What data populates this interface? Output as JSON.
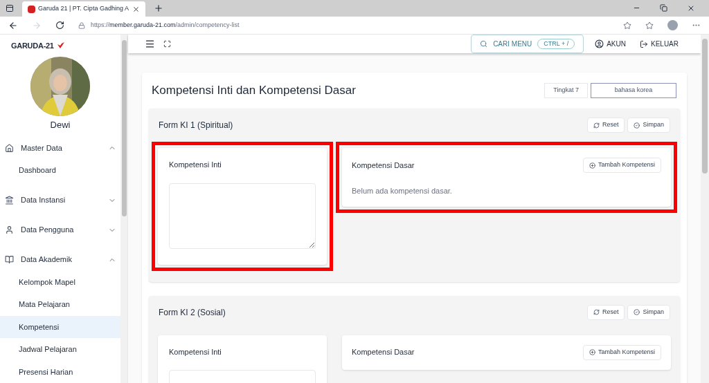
{
  "browser": {
    "tab_title": "Garuda 21 | PT. Cipta Gadhing A",
    "url_prefix": "https://",
    "url_host": "member.garuda-21.com",
    "url_path": "/admin/competency-list"
  },
  "sidebar": {
    "logo": "GARUDA-21",
    "user_name": "Dewi",
    "groups": [
      {
        "label": "Master Data",
        "expanded": true,
        "children": [
          {
            "label": "Dashboard",
            "selected": false
          }
        ]
      },
      {
        "label": "Data Instansi",
        "expanded": false
      },
      {
        "label": "Data Pengguna",
        "expanded": false
      },
      {
        "label": "Data Akademik",
        "expanded": true,
        "children": [
          {
            "label": "Kelompok Mapel",
            "selected": false
          },
          {
            "label": "Mata Pelajaran",
            "selected": false
          },
          {
            "label": "Kompetensi",
            "selected": true
          },
          {
            "label": "Jadwal Pelajaran",
            "selected": false
          },
          {
            "label": "Presensi Harian",
            "selected": false
          }
        ]
      }
    ]
  },
  "header": {
    "search_label": "CARI MENU",
    "shortcut": "CTRL + /",
    "account": "AKUN",
    "logout": "KELUAR"
  },
  "page": {
    "title": "Kompetensi Inti dan Kompetensi Dasar",
    "grade": "Tingkat 7",
    "subject": "bahasa korea"
  },
  "forms": [
    {
      "title": "Form KI 1 (Spiritual)",
      "reset": "Reset",
      "save": "Simpan",
      "ki": {
        "title": "Kompetensi Inti",
        "highlighted": true
      },
      "kd": {
        "title": "Kompetensi Dasar",
        "add": "Tambah Kompetensi",
        "empty": "Belum ada kompetensi dasar.",
        "highlighted": true
      }
    },
    {
      "title": "Form KI 2 (Sosial)",
      "reset": "Reset",
      "save": "Simpan",
      "ki": {
        "title": "Kompetensi Inti",
        "highlighted": false
      },
      "kd": {
        "title": "Kompetensi Dasar",
        "add": "Tambah Kompetensi",
        "highlighted": false
      }
    }
  ]
}
